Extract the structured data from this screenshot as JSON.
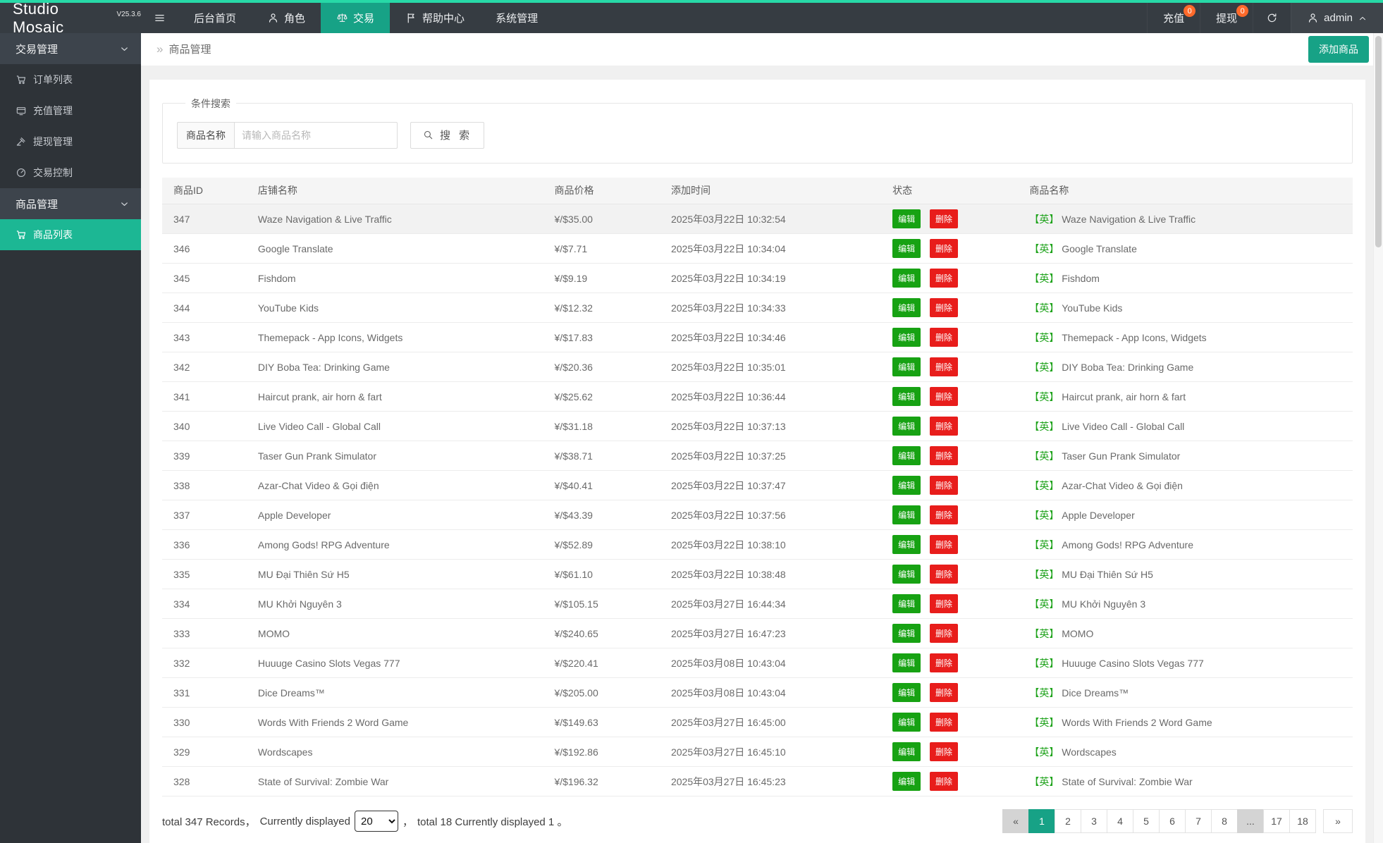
{
  "colors": {
    "accent": "#17a286",
    "accent-bright": "#1cb794",
    "top-strip": "#27d9a7",
    "badge": "#ff6a2b",
    "edit-green": "#17a213",
    "delete-red": "#e81d1b",
    "lang-green": "#1fa31c"
  },
  "app": {
    "brand": "Studio Mosaic",
    "version": "V25.3.6"
  },
  "navbar": {
    "home": "后台首页",
    "role": "角色",
    "trade": "交易",
    "help": "帮助中心",
    "system": "系统管理",
    "recharge": "充值",
    "recharge_badge": "0",
    "withdraw": "提现",
    "withdraw_badge": "0",
    "user": "admin"
  },
  "sidebar": {
    "group_trade": "交易管理",
    "order_list": "订单列表",
    "recharge_mgmt": "充值管理",
    "withdraw_mgmt": "提现管理",
    "trade_control": "交易控制",
    "group_product": "商品管理",
    "product_list": "商品列表"
  },
  "breadcrumb": {
    "chevron": "»",
    "label": "商品管理"
  },
  "toolbar": {
    "add_label": "添加商品"
  },
  "search": {
    "legend": "条件搜索",
    "field_label": "商品名称",
    "placeholder": "请输入商品名称",
    "button": "搜 索"
  },
  "table": {
    "headers": [
      "商品ID",
      "店铺名称",
      "商品价格",
      "添加时间",
      "状态",
      "商品名称"
    ],
    "edit_label": "编辑",
    "delete_label": "删除",
    "lang_tag": "【英】",
    "rows": [
      {
        "id": "347",
        "store": "Waze Navigation & Live Traffic",
        "price": "¥/$35.00",
        "time": "2025年03月22日 10:32:54",
        "name": "Waze Navigation & Live Traffic"
      },
      {
        "id": "346",
        "store": "Google Translate",
        "price": "¥/$7.71",
        "time": "2025年03月22日 10:34:04",
        "name": "Google Translate"
      },
      {
        "id": "345",
        "store": "Fishdom",
        "price": "¥/$9.19",
        "time": "2025年03月22日 10:34:19",
        "name": "Fishdom"
      },
      {
        "id": "344",
        "store": "YouTube Kids",
        "price": "¥/$12.32",
        "time": "2025年03月22日 10:34:33",
        "name": "YouTube Kids"
      },
      {
        "id": "343",
        "store": "Themepack - App Icons, Widgets",
        "price": "¥/$17.83",
        "time": "2025年03月22日 10:34:46",
        "name": "Themepack - App Icons, Widgets"
      },
      {
        "id": "342",
        "store": "DIY Boba Tea: Drinking Game",
        "price": "¥/$20.36",
        "time": "2025年03月22日 10:35:01",
        "name": "DIY Boba Tea: Drinking Game"
      },
      {
        "id": "341",
        "store": "Haircut prank, air horn & fart",
        "price": "¥/$25.62",
        "time": "2025年03月22日 10:36:44",
        "name": "Haircut prank, air horn & fart"
      },
      {
        "id": "340",
        "store": "Live Video Call - Global Call",
        "price": "¥/$31.18",
        "time": "2025年03月22日 10:37:13",
        "name": "Live Video Call - Global Call"
      },
      {
        "id": "339",
        "store": "Taser Gun Prank Simulator",
        "price": "¥/$38.71",
        "time": "2025年03月22日 10:37:25",
        "name": "Taser Gun Prank Simulator"
      },
      {
        "id": "338",
        "store": "Azar-Chat Video & Gọi điện",
        "price": "¥/$40.41",
        "time": "2025年03月22日 10:37:47",
        "name": "Azar-Chat Video & Gọi điện"
      },
      {
        "id": "337",
        "store": "Apple Developer",
        "price": "¥/$43.39",
        "time": "2025年03月22日 10:37:56",
        "name": "Apple Developer"
      },
      {
        "id": "336",
        "store": "Among Gods! RPG Adventure",
        "price": "¥/$52.89",
        "time": "2025年03月22日 10:38:10",
        "name": "Among Gods! RPG Adventure"
      },
      {
        "id": "335",
        "store": "MU Đại Thiên Sứ H5",
        "price": "¥/$61.10",
        "time": "2025年03月22日 10:38:48",
        "name": "MU Đại Thiên Sứ H5"
      },
      {
        "id": "334",
        "store": "MU Khởi Nguyên 3",
        "price": "¥/$105.15",
        "time": "2025年03月27日 16:44:34",
        "name": "MU Khởi Nguyên 3"
      },
      {
        "id": "333",
        "store": "MOMO",
        "price": "¥/$240.65",
        "time": "2025年03月27日 16:47:23",
        "name": "MOMO"
      },
      {
        "id": "332",
        "store": "Huuuge Casino Slots Vegas 777",
        "price": "¥/$220.41",
        "time": "2025年03月08日 10:43:04",
        "name": "Huuuge Casino Slots Vegas 777"
      },
      {
        "id": "331",
        "store": "Dice Dreams™",
        "price": "¥/$205.00",
        "time": "2025年03月08日 10:43:04",
        "name": "Dice Dreams™"
      },
      {
        "id": "330",
        "store": "Words With Friends 2 Word Game",
        "price": "¥/$149.63",
        "time": "2025年03月27日 16:45:00",
        "name": "Words With Friends 2 Word Game"
      },
      {
        "id": "329",
        "store": "Wordscapes",
        "price": "¥/$192.86",
        "time": "2025年03月27日 16:45:10",
        "name": "Wordscapes"
      },
      {
        "id": "328",
        "store": "State of Survival: Zombie War",
        "price": "¥/$196.32",
        "time": "2025年03月27日 16:45:23",
        "name": "State of Survival: Zombie War"
      }
    ]
  },
  "pagination": {
    "summary_prefix": "total 347 Records，",
    "summary_mid": "Currently displayed",
    "page_size": "20",
    "summary_comma": "，",
    "summary_suffix": "total 18 Currently displayed 1 。",
    "pages": [
      {
        "label": "«",
        "style": "gray"
      },
      {
        "label": "1",
        "style": "active"
      },
      {
        "label": "2"
      },
      {
        "label": "3"
      },
      {
        "label": "4"
      },
      {
        "label": "5"
      },
      {
        "label": "6"
      },
      {
        "label": "7"
      },
      {
        "label": "8"
      },
      {
        "label": "...",
        "style": "gray"
      },
      {
        "label": "17"
      },
      {
        "label": "18"
      },
      {
        "label": "»",
        "style": "last"
      }
    ]
  }
}
